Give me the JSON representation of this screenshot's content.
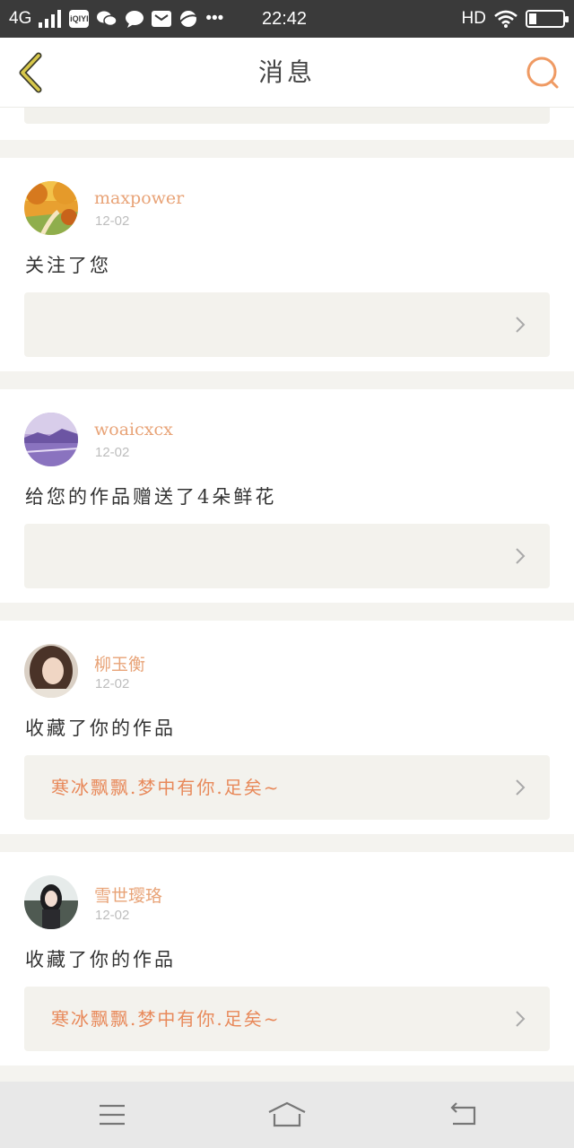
{
  "status_bar": {
    "network": "4G",
    "app_icons": [
      "iqiyi-icon",
      "wechat-icon",
      "chat-bubble-icon",
      "mail-icon",
      "planet-icon"
    ],
    "more": "•••",
    "time": "22:42",
    "hd": "HD",
    "battery_level": 0.2
  },
  "header": {
    "title": "消息"
  },
  "messages": [
    {
      "username": "maxpower",
      "date": "12-02",
      "text": "关注了您",
      "ref": ""
    },
    {
      "username": "woaicxcx",
      "date": "12-02",
      "text": "给您的作品赠送了4朵鲜花",
      "ref": ""
    },
    {
      "username": "柳玉衡",
      "date": "12-02",
      "text": "收藏了你的作品",
      "ref": "寒冰飘飘.梦中有你.足矣~"
    },
    {
      "username": "雪世璎珞",
      "date": "12-02",
      "text": "收藏了你的作品",
      "ref": "寒冰飘飘.梦中有你.足矣~"
    }
  ],
  "colors": {
    "accent": "#e8a377",
    "ref_text": "#e8895a",
    "back_arrow": "#c9b83a",
    "background": "#f4f3ef"
  }
}
